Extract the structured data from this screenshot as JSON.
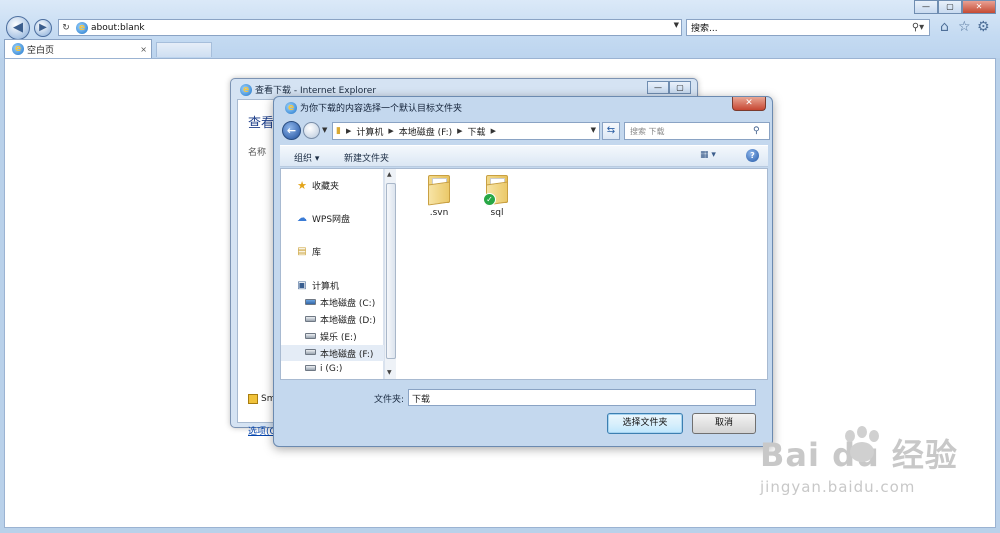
{
  "browser": {
    "address": "about:blank",
    "search_placeholder": "搜索...",
    "tab_title": "空白页",
    "tab_close": "×",
    "back_glyph": "◀",
    "forward_glyph": "▶",
    "icons": [
      "home-icon",
      "star-icon",
      "gear-icon",
      "search-icon",
      "refresh-icon"
    ]
  },
  "downloads_window": {
    "title": "查看下载 - Internet Explorer",
    "heading": "查看和",
    "column_name": "名称",
    "smartscreen": "Sm",
    "options_link": "选项(O"
  },
  "dialog": {
    "title": "为你下载的内容选择一个默认目标文件夹",
    "close": "✕",
    "breadcrumb": [
      "计算机",
      "本地磁盘 (F:)",
      "下载"
    ],
    "search_placeholder": "搜索 下载",
    "toolbar": {
      "organize": "组织 ▾",
      "new_folder": "新建文件夹"
    },
    "nav_items": [
      {
        "label": "收藏夹",
        "icon": "favorites-star-icon"
      },
      {
        "label": "WPS网盘",
        "icon": "cloud-icon"
      },
      {
        "label": "库",
        "icon": "library-icon"
      },
      {
        "label": "计算机",
        "icon": "computer-icon"
      },
      {
        "label": "本地磁盘 (C:)",
        "icon": "drive-icon"
      },
      {
        "label": "本地磁盘 (D:)",
        "icon": "drive-icon"
      },
      {
        "label": "娱乐 (E:)",
        "icon": "drive-icon"
      },
      {
        "label": "本地磁盘 (F:)",
        "icon": "drive-icon",
        "selected": true
      },
      {
        "label": "i (G:)",
        "icon": "drive-icon"
      }
    ],
    "folders": [
      {
        "name": ".svn",
        "synced": false
      },
      {
        "name": "sql",
        "synced": true
      }
    ],
    "folder_label": "文件夹:",
    "folder_value": "下载",
    "select_button": "选择文件夹",
    "cancel_button": "取消"
  },
  "watermark": {
    "brand": "Bai du 经验",
    "url": "jingyan.baidu.com"
  }
}
